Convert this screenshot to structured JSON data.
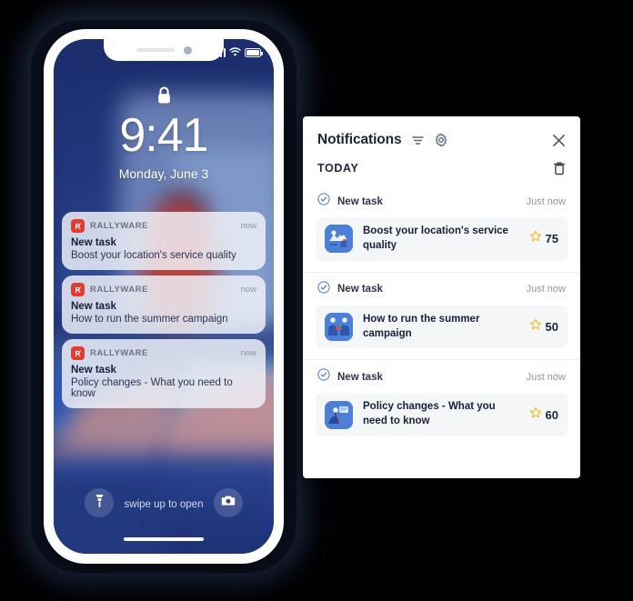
{
  "phone": {
    "status_bar": {
      "signal_icon": "cellular-signal-icon",
      "wifi_icon": "wifi-icon",
      "battery_icon": "battery-full-icon"
    },
    "lock_icon": "lock-closed-icon",
    "time": "9:41",
    "date": "Monday, June 3",
    "notifications": [
      {
        "app": "RALLYWARE",
        "time": "now",
        "title": "New task",
        "body": "Boost your location's service quality"
      },
      {
        "app": "RALLYWARE",
        "time": "now",
        "title": "New task",
        "body": "How to run the summer campaign"
      },
      {
        "app": "RALLYWARE",
        "time": "now",
        "title": "New task",
        "body": "Policy changes - What you need to know"
      }
    ],
    "bottom": {
      "flashlight_icon": "flashlight-icon",
      "camera_icon": "camera-icon",
      "swipe_hint": "swipe up to open"
    }
  },
  "panel": {
    "title": "Notifications",
    "filter_icon": "filter-icon",
    "settings_icon": "gear-icon",
    "close_icon": "close-icon",
    "section_label": "TODAY",
    "delete_icon": "trash-icon",
    "groups": [
      {
        "status_icon": "check-circle-icon",
        "title": "New task",
        "time": "Just now",
        "task_title": "Boost your location's service quality",
        "points": "75",
        "star_icon": "star-icon",
        "thumb_icon": "task-thumbnail-icon"
      },
      {
        "status_icon": "check-circle-icon",
        "title": "New task",
        "time": "Just now",
        "task_title": "How to run the summer campaign",
        "points": "50",
        "star_icon": "star-icon",
        "thumb_icon": "task-thumbnail-icon"
      },
      {
        "status_icon": "check-circle-icon",
        "title": "New task",
        "time": "Just now",
        "task_title": "Policy changes - What you need to know",
        "points": "60",
        "star_icon": "star-icon",
        "thumb_icon": "task-thumbnail-icon"
      }
    ]
  },
  "colors": {
    "background": "#000000",
    "accent_blue": "#4c7fd6",
    "star_yellow": "#f5b823",
    "app_red": "#e03c31",
    "panel_bg": "#ffffff",
    "card_bg": "#f5f6f8",
    "phone_screen": "#1d3072"
  }
}
